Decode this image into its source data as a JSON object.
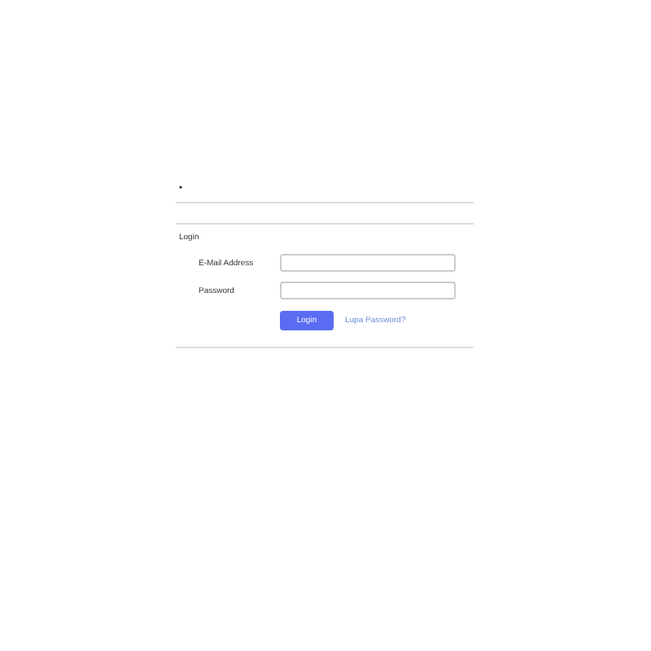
{
  "top_mark": "•",
  "card": {
    "title": "Login",
    "fields": [
      {
        "label": "E-Mail Address"
      },
      {
        "label": "Password"
      }
    ],
    "button": "Login",
    "link": "Lupa Password?"
  }
}
